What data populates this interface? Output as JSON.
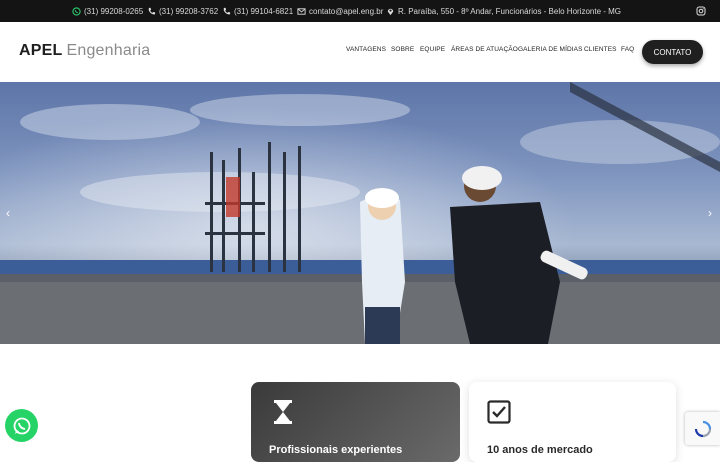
{
  "topbar": {
    "phone1": "(31) 99208-0265",
    "phone2": "(31) 99208-3762",
    "phone3": "(31) 99104-6821",
    "email": "contato@apel.eng.br",
    "address": "R. Paraíba, 550 - 8º Andar, Funcionários - Belo Horizonte - MG",
    "icons": [
      "whatsapp-icon",
      "phone-icon",
      "phone-icon",
      "envelope-icon",
      "map-pin-icon",
      "instagram-icon"
    ]
  },
  "brand": {
    "bold": "APEL",
    "light": "Engenharia"
  },
  "nav": [
    "VANTAGENS",
    "SOBRE",
    "EQUIPE",
    "ÁREAS DE ATUAÇÃO",
    "GALERIA DE MÍDIAS",
    "CLIENTES",
    "FAQ"
  ],
  "cta": "CONTATO",
  "hero": {
    "prev": "‹",
    "next": "›"
  },
  "features": {
    "card1_icon": "hourglass-icon",
    "card1_text": "Profissionais experientes",
    "card2_icon": "checkbox-icon",
    "card2_text": "10 anos de mercado"
  },
  "colors": {
    "topbar": "#141414",
    "cta": "#1f1f1f",
    "whatsapp": "#25d366"
  }
}
